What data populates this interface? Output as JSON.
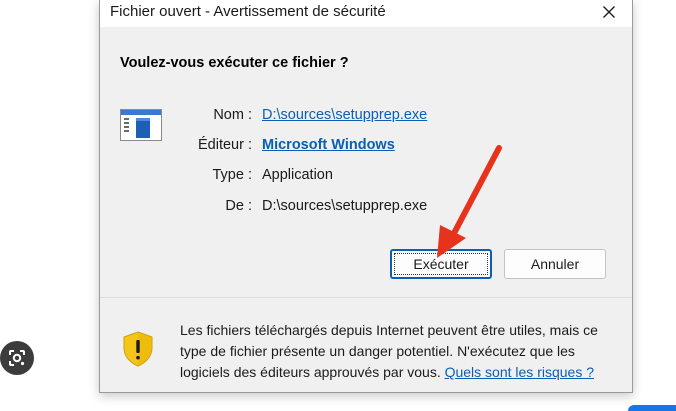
{
  "window": {
    "title": "Fichier ouvert - Avertissement de sécurité",
    "close_icon": "close-icon"
  },
  "dialog": {
    "question": "Voulez-vous exécuter ce fichier ?",
    "file_icon": "application-window-icon",
    "fields": {
      "name_label": "Nom :",
      "name_value": "D:\\sources\\setupprep.exe",
      "publisher_label": "Éditeur :",
      "publisher_value": "Microsoft Windows",
      "type_label": "Type :",
      "type_value": "Application",
      "from_label": "De :",
      "from_value": "D:\\sources\\setupprep.exe"
    },
    "buttons": {
      "run": "Exécuter",
      "cancel": "Annuler"
    },
    "warning": {
      "icon": "shield-warning-icon",
      "text": "Les fichiers téléchargés depuis Internet peuvent être utiles, mais ce type de fichier présente un danger potentiel. N'exécutez que les logiciels des éditeurs approuvés par vous.",
      "link": "Quels sont les risques ?"
    }
  },
  "overlay": {
    "annotation": "red-arrow-pointing-to-run-button",
    "lens_icon": "google-lens-icon"
  },
  "colors": {
    "link": "#0a5fb4",
    "arrow": "#e8331c",
    "dialog_bg": "#f0f0f0",
    "shield": "#f5c518"
  }
}
